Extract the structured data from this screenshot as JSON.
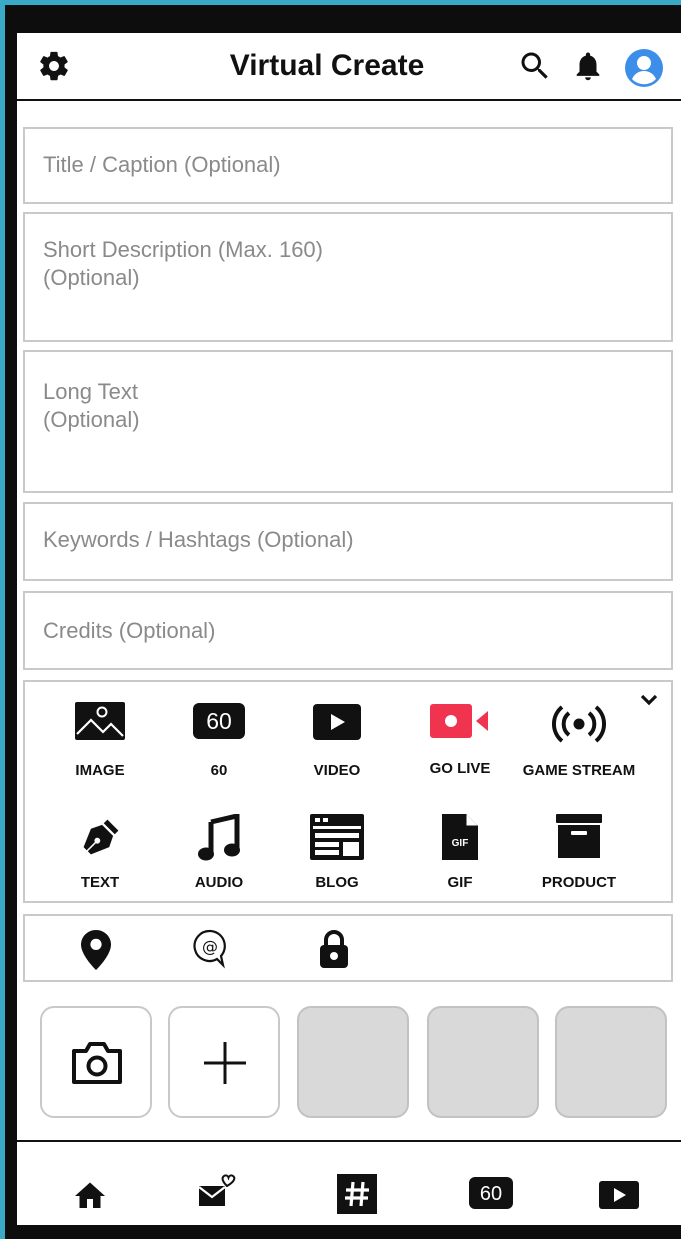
{
  "header": {
    "title": "Virtual Create",
    "icons": [
      "gear-icon",
      "search-icon",
      "bell-icon",
      "avatar-icon"
    ]
  },
  "form": {
    "title_placeholder": "Title / Caption (Optional)",
    "short_desc_placeholder": "Short Description (Max. 160)\n(Optional)",
    "long_text_placeholder": "Long Text\n(Optional)",
    "keywords_placeholder": "Keywords / Hashtags (Optional)",
    "credits_placeholder": "Credits (Optional)"
  },
  "media_types": {
    "image": "IMAGE",
    "sixty": "60",
    "sixty_badge": "60",
    "video": "VIDEO",
    "go_live": "GO LIVE",
    "game_stream": "GAME STREAM",
    "text": "TEXT",
    "audio": "AUDIO",
    "blog": "BLOG",
    "gif": "GIF",
    "gif_badge": "GIF",
    "product": "PRODUCT",
    "go_live_color": "#f0344f"
  },
  "options": {
    "icons": [
      "location-pin-icon",
      "mention-icon",
      "lock-icon"
    ]
  },
  "attachments": {
    "tiles": [
      "camera",
      "add",
      "empty",
      "empty",
      "empty"
    ]
  },
  "bottom_nav": {
    "sixty_badge": "60",
    "icons": [
      "home-icon",
      "mail-heart-icon",
      "hashtag-icon",
      "sixty-icon",
      "video-play-icon"
    ]
  }
}
